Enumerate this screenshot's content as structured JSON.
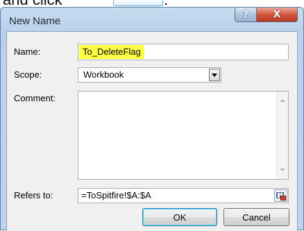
{
  "top_line": {
    "text": "and click",
    "period": "."
  },
  "dialog": {
    "title": "New Name",
    "help_label": "?",
    "close_label": "X",
    "name_label": "Name:",
    "name_value": "To_DeleteFlag",
    "scope_label": "Scope:",
    "scope_value": "Workbook",
    "comment_label": "Comment:",
    "comment_value": "",
    "refers_label": "Refers to:",
    "refers_value": "=ToSpitfire!$A:$A",
    "ok_label": "OK",
    "cancel_label": "Cancel"
  },
  "colors": {
    "highlight": "#ffff44",
    "title_bar": "#b9d1ea",
    "close_button": "#c84a30"
  }
}
